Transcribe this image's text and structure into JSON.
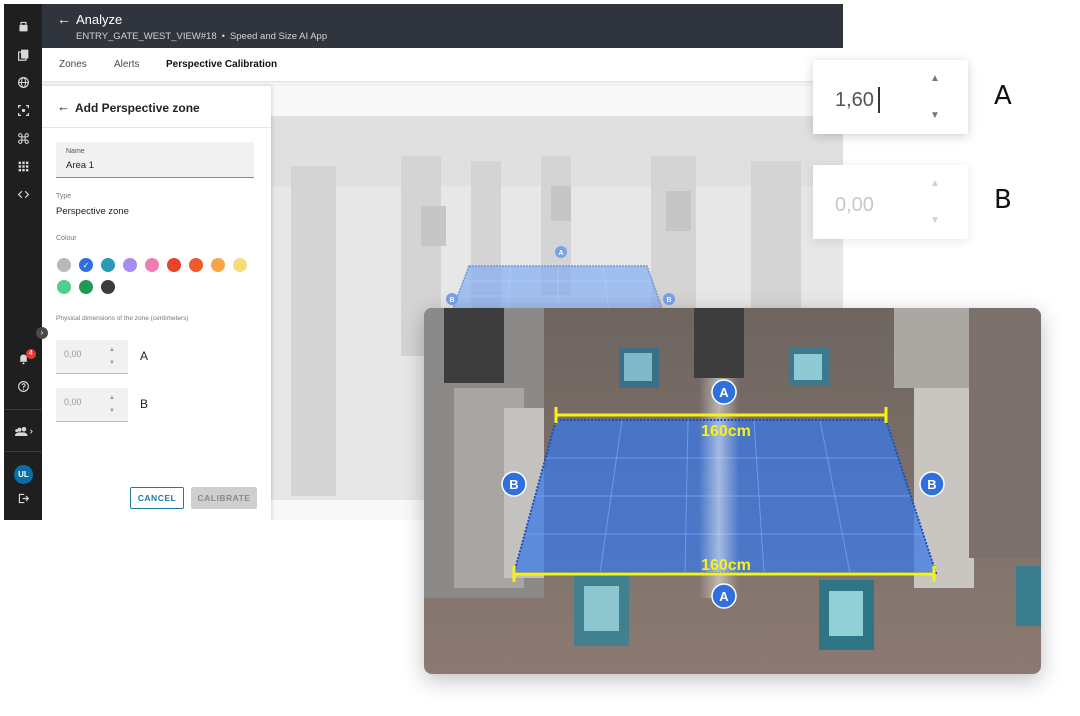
{
  "header": {
    "title": "Analyze",
    "camera": "ENTRY_GATE_WEST_VIEW#18",
    "app_name": "Speed and Size AI App"
  },
  "tabs": [
    {
      "label": "Zones",
      "active": false
    },
    {
      "label": "Alerts",
      "active": false
    },
    {
      "label": "Perspective Calibration",
      "active": true
    }
  ],
  "rail": {
    "notification_count": "4",
    "user_initials": "UL"
  },
  "panel": {
    "title": "Add Perspective zone",
    "name_label": "Name",
    "name_value": "Area 1",
    "type_label": "Type",
    "type_value": "Perspective zone",
    "colour_label": "Colour",
    "colours": [
      "#b8b8b8",
      "#2f6fde",
      "#2a9bb5",
      "#a88cf2",
      "#ef7fb0",
      "#e8442c",
      "#f05a28",
      "#f6a34a",
      "#f7dd7a",
      "#4fcf8d",
      "#1f9a55",
      "#3c3c3c"
    ],
    "selected_colour": "#2f6fde",
    "dimensions_label": "Physical dimensions of the zone (centimeters)",
    "dimension_a": {
      "value": "0,00",
      "tag": "A"
    },
    "dimension_b": {
      "value": "0,00",
      "tag": "B"
    },
    "cancel_label": "CANCEL",
    "calibrate_label": "CALIBRATE"
  },
  "zoom": {
    "a_value": "1,60",
    "a_tag": "A",
    "b_value": "0,00",
    "b_tag": "B"
  },
  "overlay": {
    "marker_a": "A",
    "marker_b": "B",
    "top_measure": "160cm",
    "bottom_measure": "160cm"
  }
}
